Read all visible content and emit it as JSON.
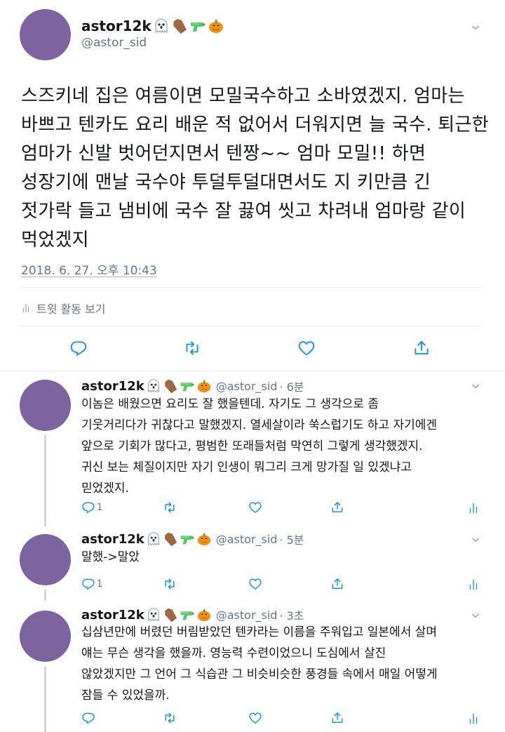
{
  "main_tweet": {
    "display_name": "astor12k",
    "handle": "@astor_sid",
    "lines": [
      "스즈키네 집은 여름이면 모밀국수하고 소바였겠지. 엄마는",
      "바쁘고 텐카도 요리 배운 적 없어서 더워지면 늘 국수. 퇴근한",
      "엄마가 신발 벗어던지면서 텐짱~~ 엄마 모밀!! 하면",
      "성장기에 맨날 국수야 투덜투덜대면서도 지 키만큼 긴",
      "젓가락 들고 냄비에 국수 잘 끓여 씻고 차려내 엄마랑 같이",
      "먹었겠지"
    ],
    "timestamp": "2018. 6. 27. 오후 10:43",
    "activity_label": "트윗 활동 보기"
  },
  "emoji_icons": [
    "ghost-emoji",
    "coffin-emoji",
    "water-pistol-emoji",
    "jack-o-lantern-emoji"
  ],
  "replies": [
    {
      "display_name": "astor12k",
      "handle": "@astor_sid",
      "time": "· 6분",
      "lines": [
        "이놈은 배웠으면 요리도 잘 했을텐데. 자기도 그 생각으로 좀",
        "기웃거리다가 귀찮다고 말했겠지. 열세살이라 쑥스럽기도 하고 자기에겐",
        "앞으로 기회가 많다고, 평범한 또래들처럼 막연히 그렇게 생각했겠지.",
        "귀신 보는 체질이지만 자기 인생이 뭐그리 크게 망가질 일 있겠냐고",
        "믿었겠지."
      ],
      "reply_count": "1"
    },
    {
      "display_name": "astor12k",
      "handle": "@astor_sid",
      "time": "· 5분",
      "lines": [
        "말했->말았"
      ],
      "reply_count": "1"
    },
    {
      "display_name": "astor12k",
      "handle": "@astor_sid",
      "time": "· 3초",
      "lines": [
        "십삼년만에 버렸던 버림받았던 텐카라는 이름을 주워입고 일본에서 살며",
        "얘는 무슨 생각을 했을까. 영능력 수련이었으니 도심에서 살진",
        "않았겠지만 그 언어 그 식습관 그 비슷비슷한 풍경들 속에서 매일 어떻게",
        "잠들 수 있었을까."
      ],
      "reply_count": ""
    }
  ],
  "colors": {
    "avatar": "#7d649e",
    "secondary_text": "#657786",
    "icon": "#1b95e0",
    "thread_line": "#ccd6dd"
  }
}
